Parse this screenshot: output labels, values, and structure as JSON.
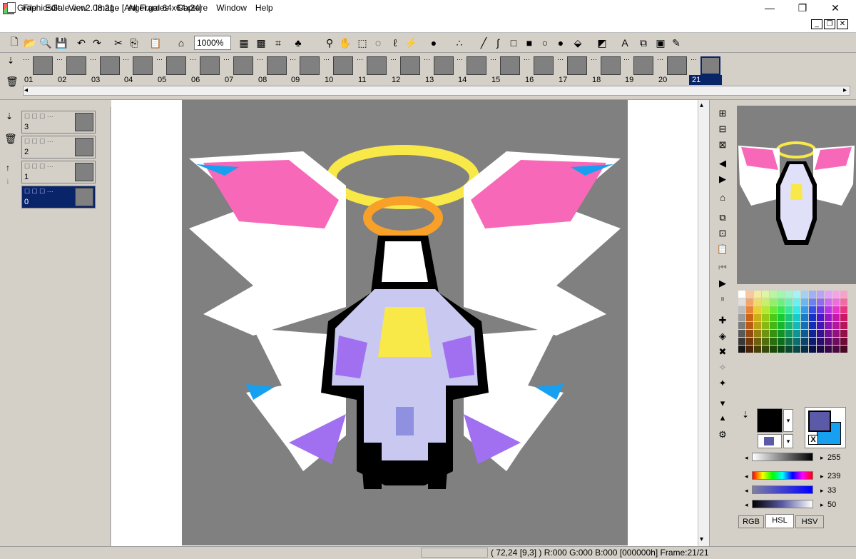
{
  "window": {
    "title": "GraphicsGale ver.2.08.21 - [Angel.gal 64x64x24]",
    "minimize": "—",
    "restore": "❐",
    "close": "✕"
  },
  "menu": [
    "File",
    "Edit",
    "View",
    "Image",
    "All Frames",
    "Capture",
    "Window",
    "Help"
  ],
  "mdi_buttons": [
    "_",
    "❐",
    "✕"
  ],
  "toolbar": {
    "zoom": "1000%",
    "icons": [
      "new-icon",
      "open-icon",
      "zoom-icon",
      "save-icon",
      "undo-icon",
      "redo-icon",
      "cut-icon",
      "copy-icon",
      "paste-icon",
      "stamp-icon",
      "grid-icon",
      "grid-fine-icon",
      "crop-icon",
      "tree-icon",
      "magnify-icon",
      "hand-icon",
      "select-rect-icon",
      "select-lasso-icon",
      "select-freehand-icon",
      "magic-wand-icon",
      "brush-icon",
      "spray-icon",
      "line-icon",
      "curve-icon",
      "rect-icon",
      "filled-rect-icon",
      "ellipse-icon",
      "filled-ellipse-icon",
      "fill-icon",
      "gradient-icon",
      "text-icon",
      "dither-icon",
      "palette-swap-icon",
      "pencil-icon"
    ]
  },
  "frames": [
    "01",
    "02",
    "03",
    "04",
    "05",
    "06",
    "07",
    "08",
    "09",
    "10",
    "11",
    "12",
    "13",
    "14",
    "15",
    "16",
    "17",
    "18",
    "19",
    "20",
    "21"
  ],
  "selected_frame": "21",
  "layers": [
    {
      "name": "3",
      "selected": false
    },
    {
      "name": "2",
      "selected": false
    },
    {
      "name": "1",
      "selected": false
    },
    {
      "name": "0",
      "selected": true
    }
  ],
  "sliders": [
    {
      "name": "lightness",
      "value": "255"
    },
    {
      "name": "hue",
      "value": "239"
    },
    {
      "name": "saturation",
      "value": "33"
    },
    {
      "name": "luminance",
      "value": "50"
    }
  ],
  "tabs": [
    "RGB",
    "HSL",
    "HSV"
  ],
  "active_tab": "HSL",
  "secondary_color_label": "X",
  "status": "( 72,24 [9,3] ) R:000 G:000 B:000  [000000h]  Frame:21/21",
  "colors": {
    "canvas_bg": "#808080",
    "selection": "#0a246a",
    "primary": "#000000",
    "secondary": "#5a5aa8",
    "big_swatch_front": "#5a5aa8",
    "big_swatch_back": "#18a0f0"
  }
}
